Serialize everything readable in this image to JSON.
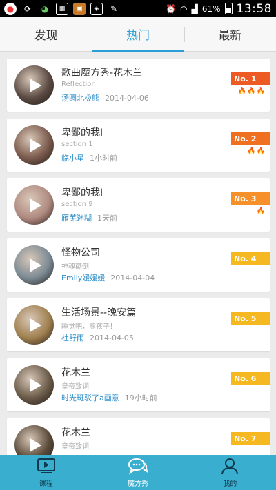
{
  "status_bar": {
    "left_icons": [
      "weibo-icon",
      "sync-icon",
      "wechat-icon",
      "calendar-icon",
      "app-icon",
      "shield-icon",
      "pen-icon"
    ],
    "battery": "61%",
    "time": "13:58"
  },
  "tabs": [
    {
      "label": "发现",
      "active": false
    },
    {
      "label": "热门",
      "active": true
    },
    {
      "label": "最新",
      "active": false
    }
  ],
  "items": [
    {
      "title": "歌曲魔方秀-花木兰",
      "subtitle": "Reflection",
      "author": "汤圆北极熊",
      "time": "2014-04-06",
      "rank": "No. 1",
      "fires": 3,
      "rank_color": "#ee5a24",
      "thumb_color": "#5a4a42"
    },
    {
      "title": "卑鄙的我Ⅰ",
      "subtitle": "section 1",
      "author": "临小星",
      "time": "1小时前",
      "rank": "No. 2",
      "fires": 2,
      "rank_color": "#f07021",
      "thumb_color": "#7a5a4c"
    },
    {
      "title": "卑鄙的我Ⅰ",
      "subtitle": "section 9",
      "author": "雁芜迷糊",
      "time": "1天前",
      "rank": "No. 3",
      "fires": 1,
      "rank_color": "#f5902a",
      "thumb_color": "#b08a80"
    },
    {
      "title": "怪物公司",
      "subtitle": "神魂颠倒",
      "author": "Emily媛媛媛",
      "time": "2014-04-04",
      "rank": "No. 4",
      "fires": 0,
      "rank_color": "#f5b820",
      "thumb_color": "#7c8a94"
    },
    {
      "title": "生活场景--晚安篇",
      "subtitle": "睡觉吧，熊孩子！",
      "author": "杜舒雨",
      "time": "2014-04-05",
      "rank": "No. 5",
      "fires": 0,
      "rank_color": "#f5b820",
      "thumb_color": "#a08050"
    },
    {
      "title": "花木兰",
      "subtitle": "皇帝致词",
      "author": "时光斑驳了a画意",
      "time": "19小时前",
      "rank": "No. 6",
      "fires": 0,
      "rank_color": "#f5b820",
      "thumb_color": "#6a5a48"
    },
    {
      "title": "花木兰",
      "subtitle": "皇帝致词",
      "author": "",
      "time": "",
      "rank": "No. 7",
      "fires": 0,
      "rank_color": "#f5b820",
      "thumb_color": "#5a4a3a"
    }
  ],
  "bottom_nav": [
    {
      "label": "课程",
      "icon": "video-icon",
      "active": false
    },
    {
      "label": "魔方秀",
      "icon": "chat-bubble-icon",
      "active": true
    },
    {
      "label": "我的",
      "icon": "user-icon",
      "active": false
    }
  ],
  "colors": {
    "accent": "#2b9ed6",
    "bottom_bar": "#3aaecf"
  }
}
